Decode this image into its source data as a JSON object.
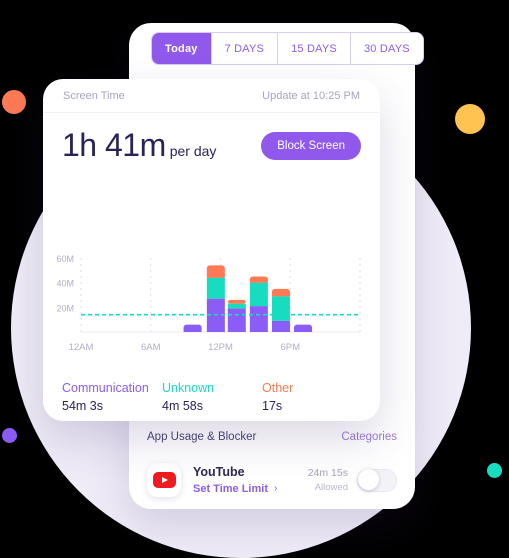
{
  "theme": {
    "purple": "#8b5cf6",
    "purple_deep": "#9059ec",
    "teal": "#17dcc0",
    "orange": "#fd7a55",
    "yellow": "#ffc352",
    "text_dark": "#2b2356",
    "text_muted": "#a9a4bf",
    "bg_circle": "#efecf7"
  },
  "range_tabs": {
    "items": [
      {
        "label": "Today",
        "active": true
      },
      {
        "label": "7 DAYS",
        "active": false
      },
      {
        "label": "15 DAYS",
        "active": false
      },
      {
        "label": "30 DAYS",
        "active": false
      }
    ]
  },
  "screen_time_card": {
    "header": {
      "title": "Screen Time",
      "update": "Update at 10:25 PM"
    },
    "summary": {
      "duration": "1h 41m",
      "unit": "per day",
      "block_button": "Block Screen"
    },
    "legend": [
      {
        "name": "Communication",
        "value": "54m 3s",
        "color": "#8b5cf6"
      },
      {
        "name": "Unknown",
        "value": "4m 58s",
        "color": "#17dcc0"
      },
      {
        "name": "Other",
        "value": "17s",
        "color": "#fd7a55"
      }
    ]
  },
  "app_usage": {
    "title": "App Usage & Blocker",
    "categories_link": "Categories",
    "rows": [
      {
        "app": "YouTube",
        "icon": "youtube-icon",
        "action": "Set Time Limit",
        "chevron": "›",
        "time": "24m 15s",
        "status": "Allowed",
        "toggle_on": false
      }
    ]
  },
  "chart_data": {
    "type": "bar",
    "title": "",
    "xlabel": "",
    "ylabel": "",
    "stacked": true,
    "grid": true,
    "legend_position": "below",
    "ylim": [
      0,
      60
    ],
    "ytick_labels": [
      "20M",
      "40M",
      "60M"
    ],
    "yticks": [
      20,
      40,
      60
    ],
    "xtick_labels": [
      "12AM",
      "6AM",
      "12PM",
      "6PM"
    ],
    "xticks": [
      0,
      6,
      12,
      18
    ],
    "threshold_line": {
      "value": 14,
      "color": "#17dcc0",
      "style": "dashed"
    },
    "categories": [
      "10AM",
      "12PM",
      "1PM",
      "3PM",
      "5PM",
      "7PM"
    ],
    "series": [
      {
        "name": "Communication",
        "color": "#8b5cf6",
        "values": [
          6,
          27,
          19,
          21,
          9,
          6
        ]
      },
      {
        "name": "Unknown",
        "color": "#17dcc0",
        "values": [
          0,
          17,
          4,
          19,
          20,
          0
        ]
      },
      {
        "name": "Other",
        "color": "#fd7a55",
        "values": [
          0,
          10,
          3,
          5,
          6,
          0
        ]
      }
    ],
    "totals": [
      6,
      54,
      26,
      45,
      35,
      6
    ]
  }
}
